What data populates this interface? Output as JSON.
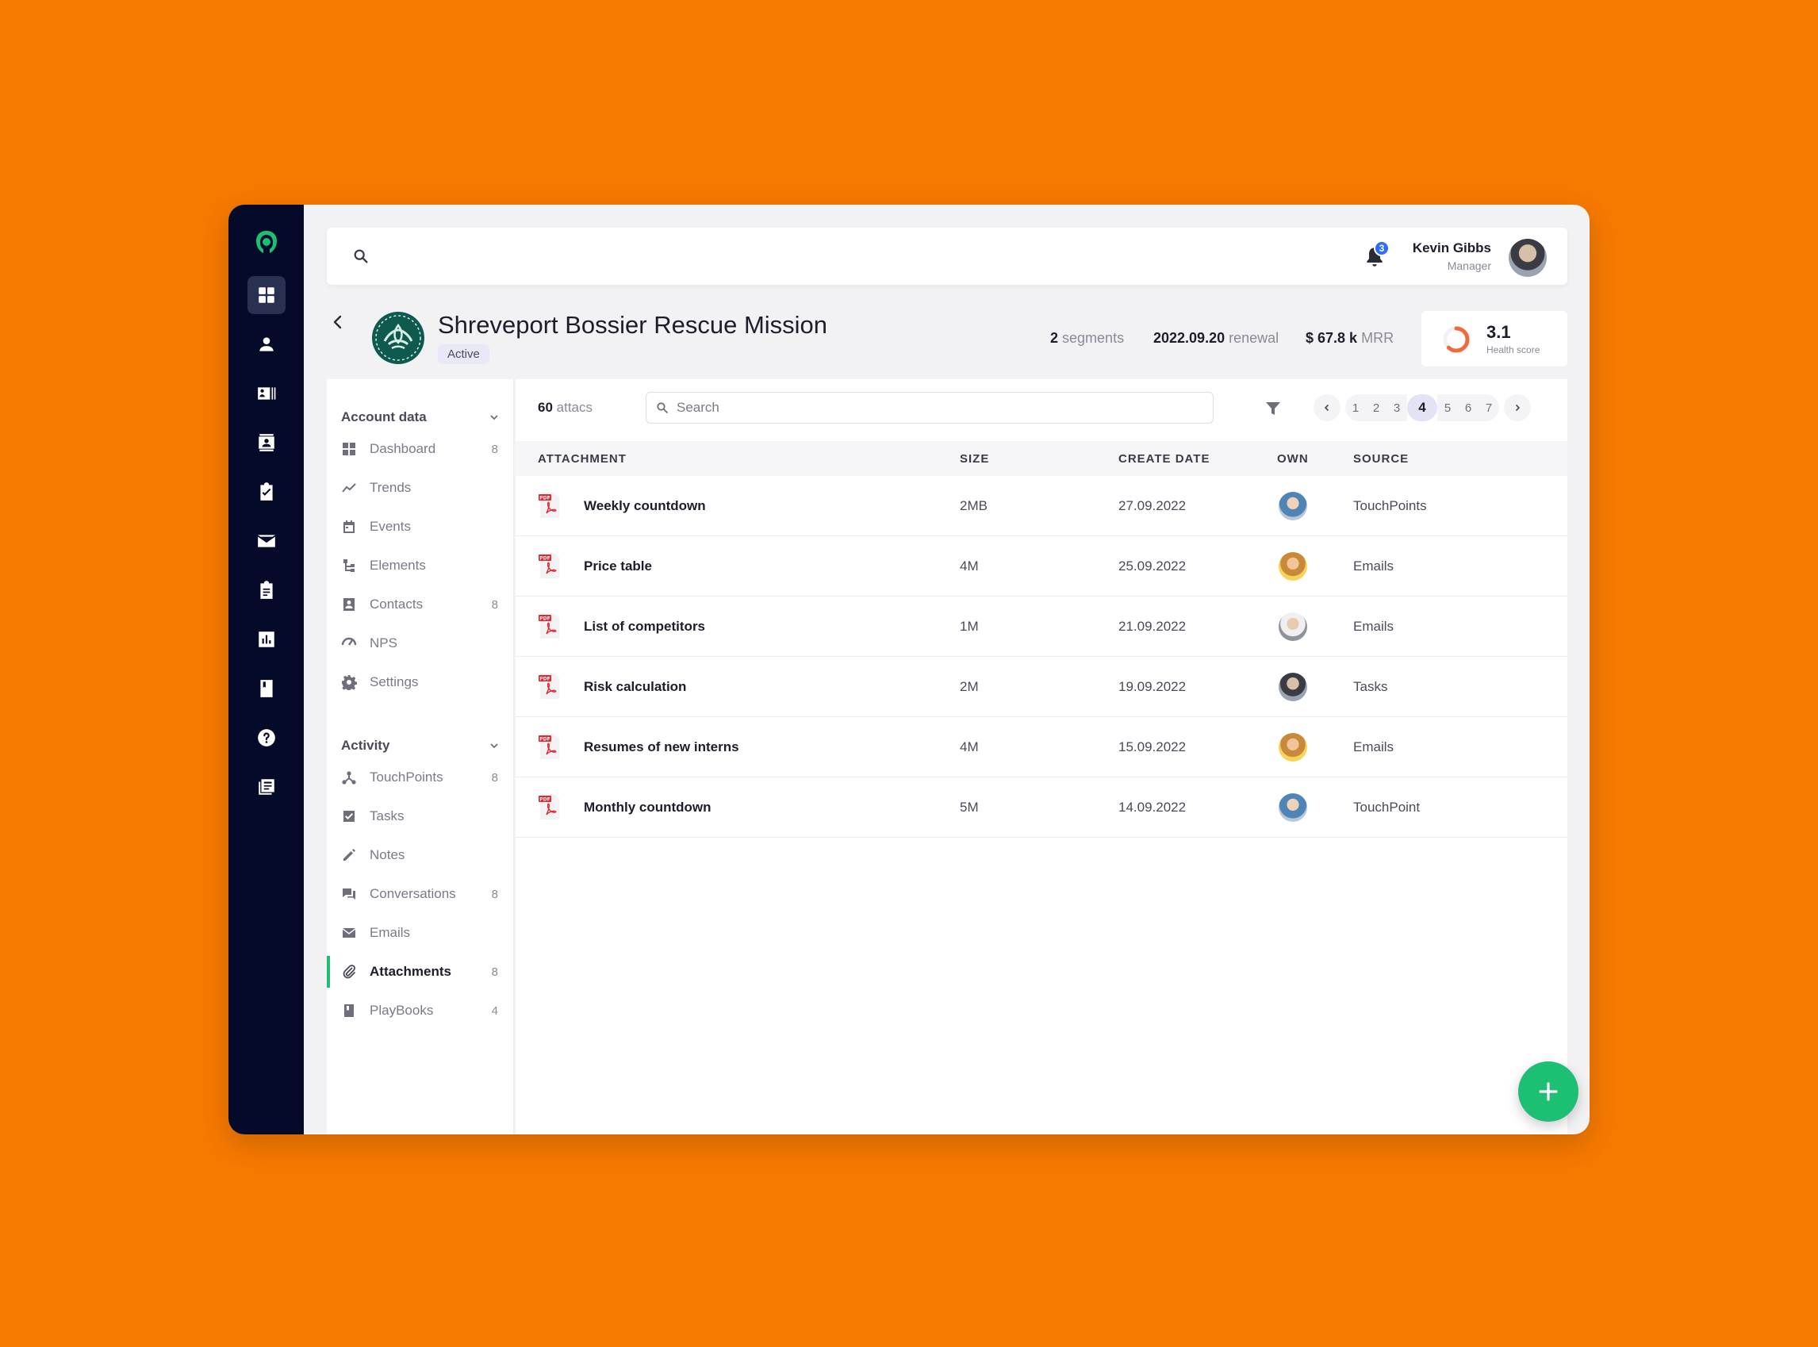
{
  "header": {
    "search_placeholder": "",
    "notifications_count": "3",
    "user": {
      "name": "Kevin Gibbs",
      "role": "Manager"
    }
  },
  "account": {
    "name": "Shreveport Bossier Rescue Mission",
    "status": "Active",
    "stats": [
      {
        "value": "2",
        "label": "segments"
      },
      {
        "value": "2022.09.20",
        "label": "renewal"
      },
      {
        "value": "$ 67.8 k",
        "label": "MRR"
      }
    ],
    "health": {
      "score": "3.1",
      "label": "Health score",
      "fraction": 0.62,
      "color": "#F06A3C"
    }
  },
  "rail": {
    "items": [
      "dashboard-icon",
      "user-icon",
      "contact-card-icon",
      "contacts-icon",
      "clipboard-check-icon",
      "mail-icon",
      "clipboard-icon",
      "bar-chart-icon",
      "book-icon",
      "help-icon",
      "news-icon"
    ]
  },
  "sidebar": {
    "sections": [
      {
        "title": "Account data",
        "items": [
          {
            "label": "Dashboard",
            "count": "8",
            "icon": "grid-icon"
          },
          {
            "label": "Trends",
            "count": "",
            "icon": "trend-icon"
          },
          {
            "label": "Events",
            "count": "",
            "icon": "calendar-icon"
          },
          {
            "label": "Elements",
            "count": "",
            "icon": "tree-icon"
          },
          {
            "label": "Contacts",
            "count": "8",
            "icon": "contacts-icon"
          },
          {
            "label": "NPS",
            "count": "",
            "icon": "gauge-icon"
          },
          {
            "label": "Settings",
            "count": "",
            "icon": "gear-icon"
          }
        ]
      },
      {
        "title": "Activity",
        "items": [
          {
            "label": "TouchPoints",
            "count": "8",
            "icon": "network-icon"
          },
          {
            "label": "Tasks",
            "count": "",
            "icon": "task-icon"
          },
          {
            "label": "Notes",
            "count": "",
            "icon": "pencil-icon"
          },
          {
            "label": "Conversations",
            "count": "8",
            "icon": "chat-icon"
          },
          {
            "label": "Emails",
            "count": "",
            "icon": "mail-icon"
          },
          {
            "label": "Attachments",
            "count": "8",
            "icon": "paperclip-icon"
          },
          {
            "label": "PlayBooks",
            "count": "4",
            "icon": "book-icon"
          }
        ]
      }
    ]
  },
  "table": {
    "count_value": "60",
    "count_label": "attacs",
    "search_placeholder": "Search",
    "pages": [
      "1",
      "2",
      "3",
      "4",
      "5",
      "6",
      "7"
    ],
    "current_page": "4",
    "columns": [
      "ATTACHMENT",
      "SIZE",
      "CREATE DATE",
      "OWN",
      "SOURCE"
    ],
    "rows": [
      {
        "name": "Weekly countdown",
        "size": "2MB",
        "date": "27.09.2022",
        "source": "TouchPoints"
      },
      {
        "name": "Price table",
        "size": "4M",
        "date": "25.09.2022",
        "source": "Emails"
      },
      {
        "name": "List of competitors",
        "size": "1M",
        "date": "21.09.2022",
        "source": "Emails"
      },
      {
        "name": "Risk calculation",
        "size": "2M",
        "date": "19.09.2022",
        "source": "Tasks"
      },
      {
        "name": "Resumes of new interns",
        "size": "4M",
        "date": "15.09.2022",
        "source": "Emails"
      },
      {
        "name": "Monthly countdown",
        "size": "5M",
        "date": "14.09.2022",
        "source": "TouchPoint"
      }
    ]
  },
  "colors": {
    "accent": "#1DBF73",
    "rail": "#050A28",
    "background": "#F77A00"
  }
}
